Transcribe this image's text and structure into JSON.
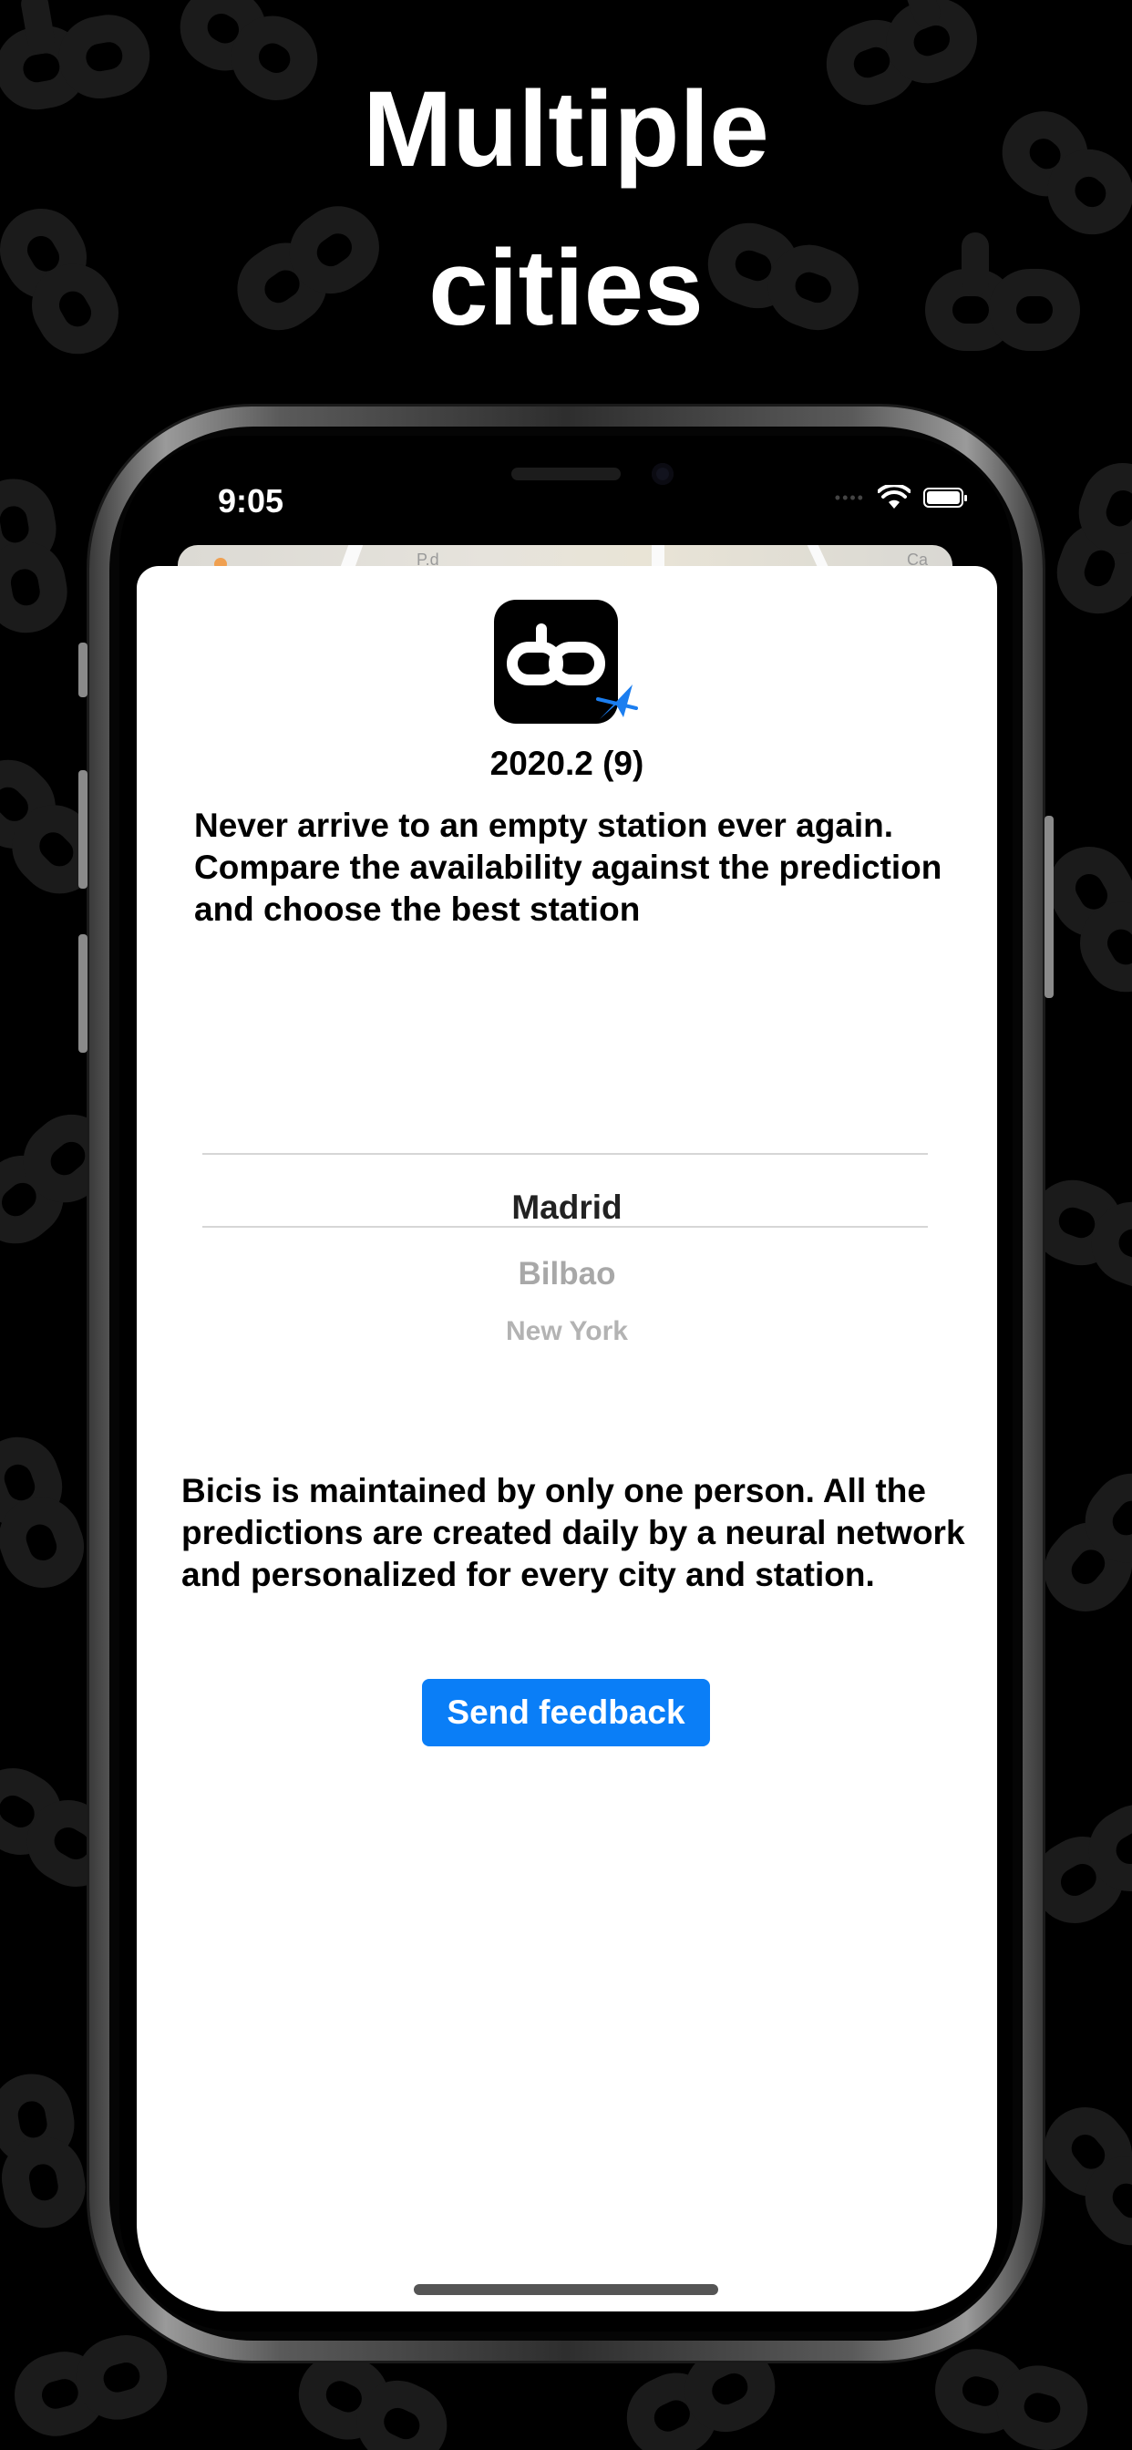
{
  "headline": {
    "line1": "Multiple",
    "line2": "cities"
  },
  "status_bar": {
    "time": "9:05",
    "signal": "••••"
  },
  "map_peek": {
    "label1": "P.d",
    "label2": "Ca"
  },
  "app": {
    "version": "2020.2 (9)"
  },
  "intro_text": "Never arrive to an empty station ever again. Compare the availability against the prediction and choose the best station",
  "city_picker": {
    "selected": "Madrid",
    "options": [
      "Bilbao",
      "New York"
    ]
  },
  "about_text": "Bicis is maintained by only one person. All the predictions are created daily by a neural network and personalized for every city and station.",
  "feedback_button": {
    "label": "Send feedback"
  },
  "colors": {
    "accent": "#0a7ef7",
    "background": "#000000",
    "sheet": "#ffffff"
  },
  "icons": [
    "app-logo-icon",
    "location-badge-icon",
    "wifi-icon",
    "battery-icon"
  ]
}
